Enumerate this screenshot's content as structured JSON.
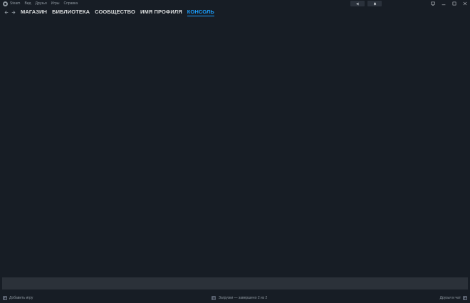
{
  "menubar": {
    "items": [
      "Steam",
      "Вид",
      "Друзья",
      "Игры",
      "Справка"
    ]
  },
  "nav": {
    "tabs": [
      "МАГАЗИН",
      "БИБЛИОТЕКА",
      "СООБЩЕСТВО",
      "ИМЯ ПРОФИЛЯ",
      "КОНСОЛЬ"
    ],
    "active_tab": "КОНСОЛЬ"
  },
  "console": {
    "input_value": ""
  },
  "bottombar": {
    "add_game": "Добавить игру",
    "downloads": "Загрузки — завершено 2 из 2",
    "friends_chat": "Друзья и чат"
  },
  "colors": {
    "background": "#171d25",
    "accent": "#1a9fff",
    "input_bg": "#2b3139"
  }
}
